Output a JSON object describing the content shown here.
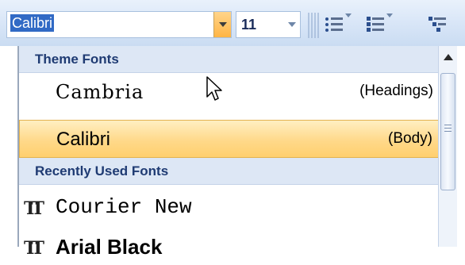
{
  "ribbon": {
    "font_name": "Calibri",
    "font_size": "11"
  },
  "dropdown": {
    "theme_header": "Theme Fonts",
    "theme_fonts": [
      {
        "name": "Cambria",
        "tag": "(Headings)"
      },
      {
        "name": "Calibri",
        "tag": "(Body)"
      }
    ],
    "recent_header": "Recently Used Fonts",
    "recent_fonts": [
      {
        "name": "Courier New"
      },
      {
        "name": "Arial Black"
      }
    ]
  },
  "icons": [
    "dropdown-arrow-icon",
    "bullets-icon",
    "numbering-icon",
    "multilevel-list-icon",
    "truetype-icon",
    "mouse-cursor-icon",
    "scroll-up-icon"
  ],
  "colors": {
    "selection_highlight": "#ffd98a",
    "header_bg": "#dde7f5",
    "header_text": "#1f3b73",
    "text_selection": "#316ac5"
  }
}
